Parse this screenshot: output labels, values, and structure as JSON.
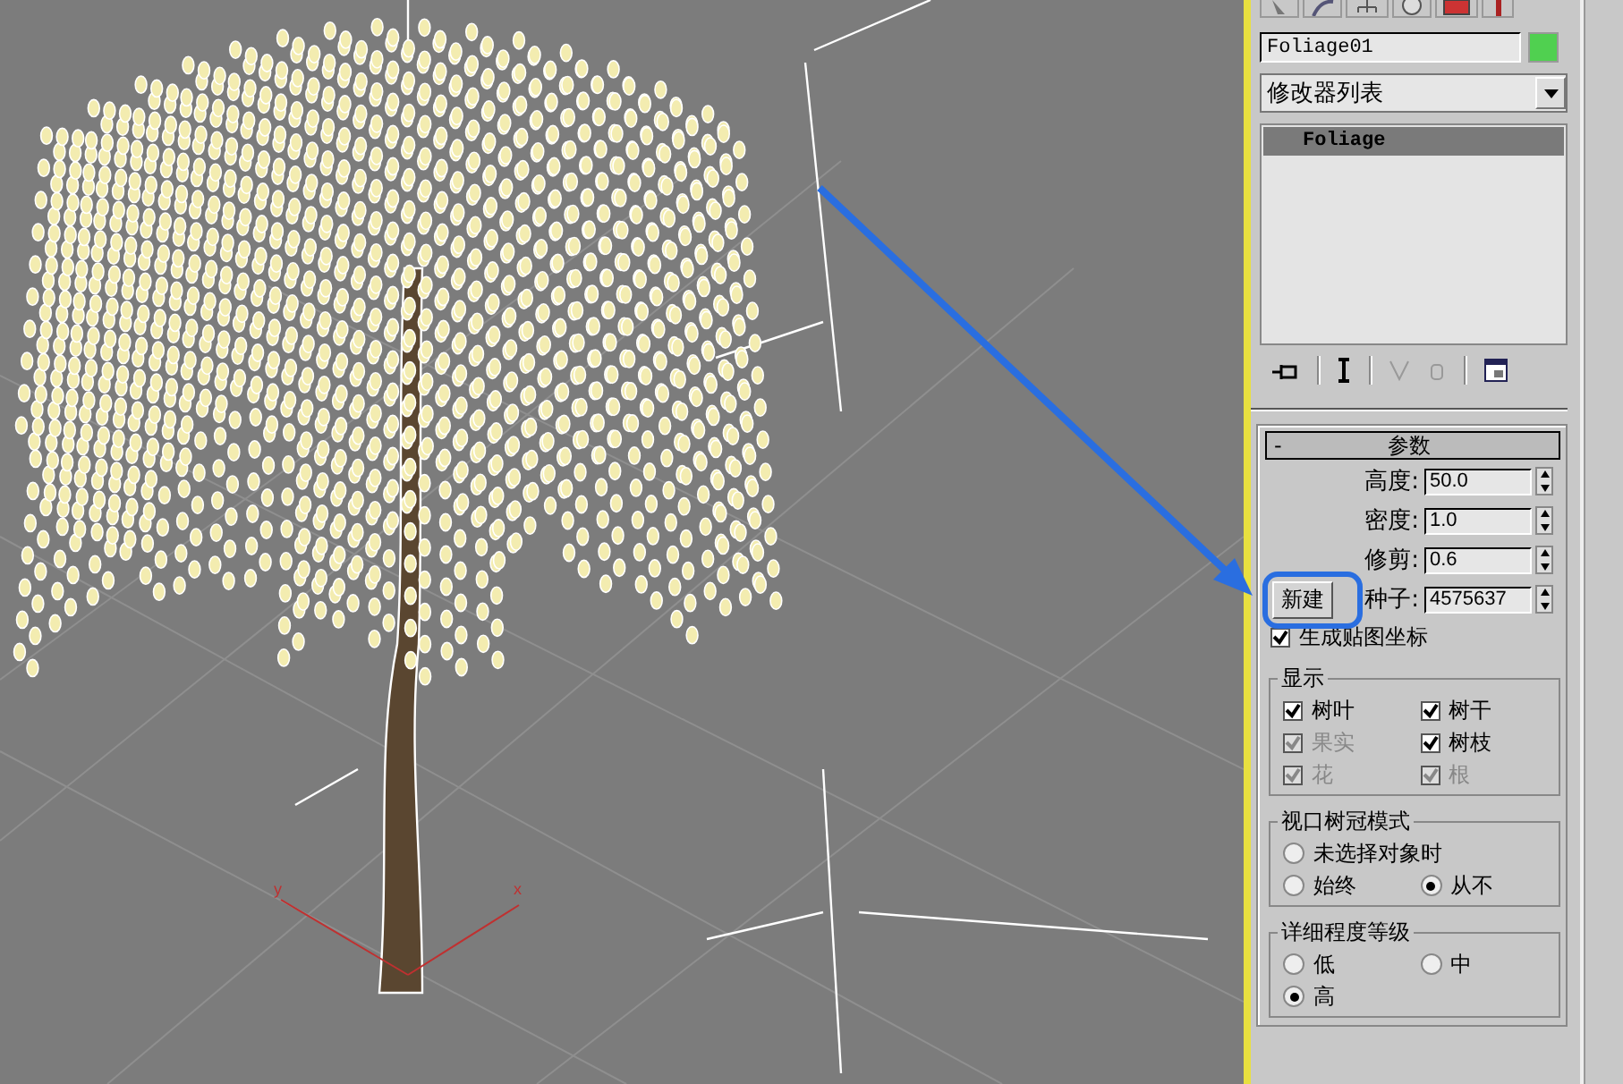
{
  "viewport": {
    "axis_labels": [
      "y",
      "x"
    ]
  },
  "panel": {
    "object_name": "Foliage01",
    "modifier_list": "修改器列表",
    "modifier_stack": [
      {
        "label": "Foliage",
        "selected": true
      }
    ],
    "rollout": {
      "collapse": "-",
      "title": "参数"
    },
    "params": [
      {
        "label": "高度:",
        "value": "50.0"
      },
      {
        "label": "密度:",
        "value": "1.0"
      },
      {
        "label": "修剪:",
        "value": "0.6"
      },
      {
        "label": "种子:",
        "value": "4575637"
      }
    ],
    "new_button": "新建",
    "gen_mapping": {
      "label": "生成贴图坐标",
      "checked": true
    },
    "display": {
      "title": "显示",
      "items": [
        {
          "label": "树叶",
          "checked": true,
          "disabled": false
        },
        {
          "label": "树干",
          "checked": true,
          "disabled": false
        },
        {
          "label": "果实",
          "checked": true,
          "disabled": true
        },
        {
          "label": "树枝",
          "checked": true,
          "disabled": false
        },
        {
          "label": "花",
          "checked": true,
          "disabled": true
        },
        {
          "label": "根",
          "checked": true,
          "disabled": true
        }
      ]
    },
    "viewport_canopy": {
      "title": "视口树冠模式",
      "options": [
        {
          "label": "未选择对象时",
          "selected": false
        },
        {
          "label": "始终",
          "selected": false
        },
        {
          "label": "从不",
          "selected": true
        }
      ]
    },
    "detail_level": {
      "title": "详细程度等级",
      "options": [
        {
          "label": "低",
          "selected": false
        },
        {
          "label": "中",
          "selected": false
        },
        {
          "label": "高",
          "selected": true
        }
      ]
    }
  }
}
